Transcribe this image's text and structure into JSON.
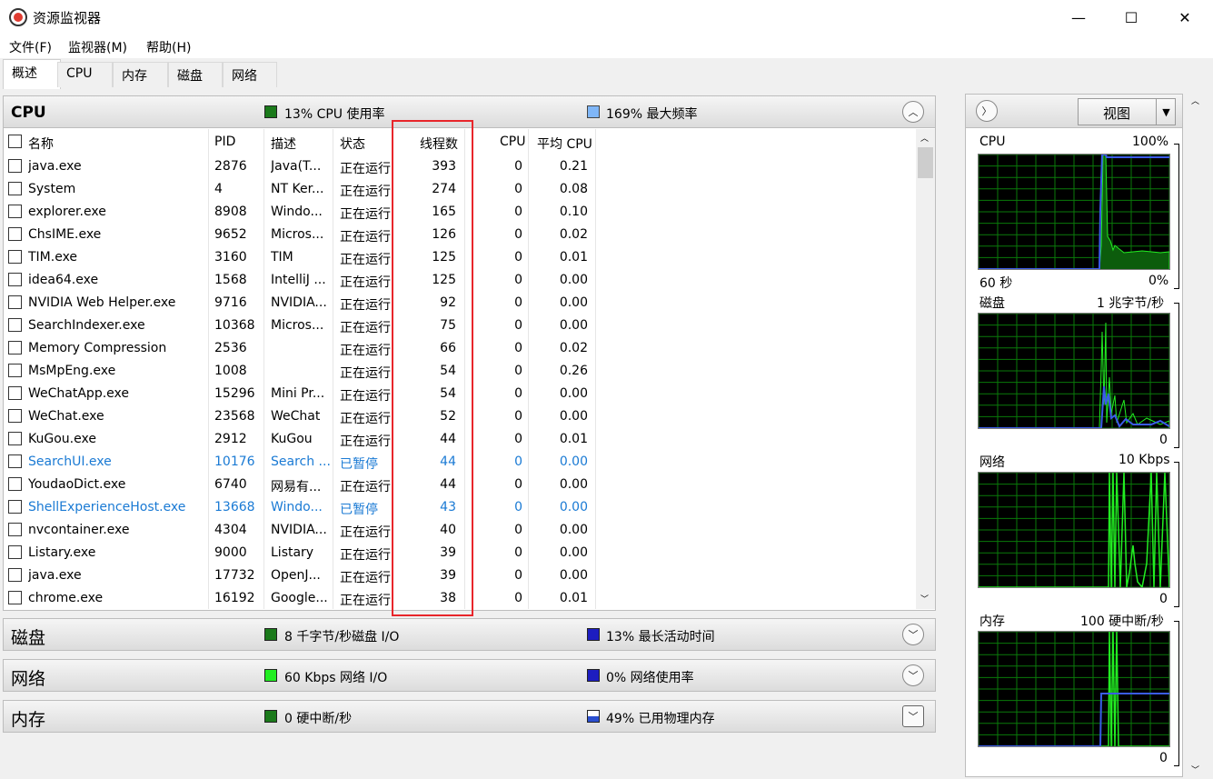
{
  "window": {
    "title": "资源监视器",
    "minimize": "—",
    "maximize": "☐",
    "close": "✕"
  },
  "menu": [
    "文件(F)",
    "监视器(M)",
    "帮助(H)"
  ],
  "tabs": [
    "概述",
    "CPU",
    "内存",
    "磁盘",
    "网络"
  ],
  "cpu_section": {
    "title": "CPU",
    "usage": "13% CPU 使用率",
    "freq": "169% 最大频率",
    "columns": [
      "名称",
      "PID",
      "描述",
      "状态",
      "线程数",
      "CPU",
      "平均 CPU"
    ],
    "rows": [
      {
        "name": "java.exe",
        "pid": "2876",
        "desc": "Java(T...",
        "status": "正在运行",
        "threads": "393",
        "cpu": "0",
        "avg": "0.21"
      },
      {
        "name": "System",
        "pid": "4",
        "desc": "NT Ker...",
        "status": "正在运行",
        "threads": "274",
        "cpu": "0",
        "avg": "0.08"
      },
      {
        "name": "explorer.exe",
        "pid": "8908",
        "desc": "Windo...",
        "status": "正在运行",
        "threads": "165",
        "cpu": "0",
        "avg": "0.10"
      },
      {
        "name": "ChsIME.exe",
        "pid": "9652",
        "desc": "Micros...",
        "status": "正在运行",
        "threads": "126",
        "cpu": "0",
        "avg": "0.02"
      },
      {
        "name": "TIM.exe",
        "pid": "3160",
        "desc": "TIM",
        "status": "正在运行",
        "threads": "125",
        "cpu": "0",
        "avg": "0.01"
      },
      {
        "name": "idea64.exe",
        "pid": "1568",
        "desc": "IntelliJ ...",
        "status": "正在运行",
        "threads": "125",
        "cpu": "0",
        "avg": "0.00"
      },
      {
        "name": "NVIDIA Web Helper.exe",
        "pid": "9716",
        "desc": "NVIDIA...",
        "status": "正在运行",
        "threads": "92",
        "cpu": "0",
        "avg": "0.00"
      },
      {
        "name": "SearchIndexer.exe",
        "pid": "10368",
        "desc": "Micros...",
        "status": "正在运行",
        "threads": "75",
        "cpu": "0",
        "avg": "0.00"
      },
      {
        "name": "Memory Compression",
        "pid": "2536",
        "desc": "",
        "status": "正在运行",
        "threads": "66",
        "cpu": "0",
        "avg": "0.02"
      },
      {
        "name": "MsMpEng.exe",
        "pid": "1008",
        "desc": "",
        "status": "正在运行",
        "threads": "54",
        "cpu": "0",
        "avg": "0.26"
      },
      {
        "name": "WeChatApp.exe",
        "pid": "15296",
        "desc": "Mini Pr...",
        "status": "正在运行",
        "threads": "54",
        "cpu": "0",
        "avg": "0.00"
      },
      {
        "name": "WeChat.exe",
        "pid": "23568",
        "desc": "WeChat",
        "status": "正在运行",
        "threads": "52",
        "cpu": "0",
        "avg": "0.00"
      },
      {
        "name": "KuGou.exe",
        "pid": "2912",
        "desc": "KuGou",
        "status": "正在运行",
        "threads": "44",
        "cpu": "0",
        "avg": "0.01"
      },
      {
        "name": "SearchUI.exe",
        "pid": "10176",
        "desc": "Search ...",
        "status": "已暂停",
        "threads": "44",
        "cpu": "0",
        "avg": "0.00",
        "paused": true
      },
      {
        "name": "YoudaoDict.exe",
        "pid": "6740",
        "desc": "网易有...",
        "status": "正在运行",
        "threads": "44",
        "cpu": "0",
        "avg": "0.00"
      },
      {
        "name": "ShellExperienceHost.exe",
        "pid": "13668",
        "desc": "Windo...",
        "status": "已暂停",
        "threads": "43",
        "cpu": "0",
        "avg": "0.00",
        "paused": true
      },
      {
        "name": "nvcontainer.exe",
        "pid": "4304",
        "desc": "NVIDIA...",
        "status": "正在运行",
        "threads": "40",
        "cpu": "0",
        "avg": "0.00"
      },
      {
        "name": "Listary.exe",
        "pid": "9000",
        "desc": "Listary",
        "status": "正在运行",
        "threads": "39",
        "cpu": "0",
        "avg": "0.00"
      },
      {
        "name": "java.exe",
        "pid": "17732",
        "desc": "OpenJ...",
        "status": "正在运行",
        "threads": "39",
        "cpu": "0",
        "avg": "0.00"
      },
      {
        "name": "chrome.exe",
        "pid": "16192",
        "desc": "Google...",
        "status": "正在运行",
        "threads": "38",
        "cpu": "0",
        "avg": "0.01"
      }
    ]
  },
  "disk_section": {
    "title": "磁盘",
    "stat1": "8 千字节/秒磁盘 I/O",
    "stat2": "13% 最长活动时间"
  },
  "network_section": {
    "title": "网络",
    "stat1": "60 Kbps 网络 I/O",
    "stat2": "0% 网络使用率"
  },
  "memory_section": {
    "title": "内存",
    "stat1": "0 硬中断/秒",
    "stat2": "49% 已用物理内存"
  },
  "right_panel": {
    "view_button": "视图",
    "graphs": [
      {
        "label": "CPU",
        "max": "100%",
        "time": "60 秒",
        "min": "0%"
      },
      {
        "label": "磁盘",
        "max": "1 兆字节/秒",
        "min": "0"
      },
      {
        "label": "网络",
        "max": "10 Kbps",
        "min": "0"
      },
      {
        "label": "内存",
        "max": "100 硬中断/秒",
        "min": "0"
      }
    ]
  },
  "colors": {
    "highlight": "#e8262b",
    "paused_text": "#1a7ad4",
    "graph_grid": "#0a7a0a",
    "graph_green": "#22ee22",
    "graph_blue": "#3a5ce8"
  }
}
